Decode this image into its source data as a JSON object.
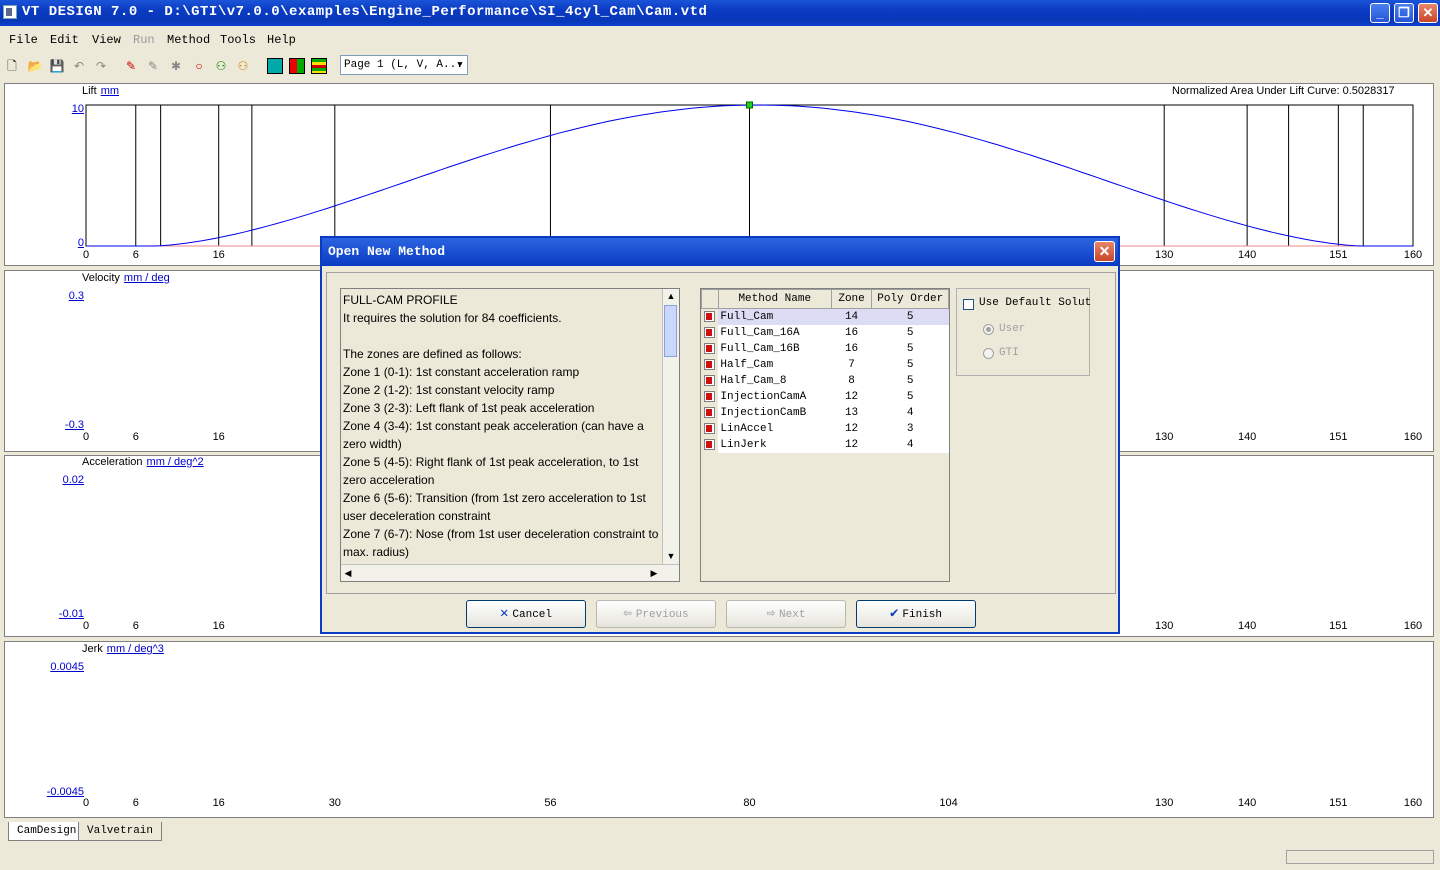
{
  "window": {
    "title": "VT DESIGN 7.0  - D:\\GTI\\v7.0.0\\examples\\Engine_Performance\\SI_4cyl_Cam\\Cam.vtd"
  },
  "menu": [
    "File",
    "Edit",
    "View",
    "Run",
    "Method",
    "Tools",
    "Help"
  ],
  "toolbar": {
    "page_select": "Page 1 (L, V, A..."
  },
  "normalized_area": "Normalized Area Under Lift Curve: 0.5028317",
  "panels": {
    "lift": {
      "name": "Lift",
      "unit": "mm",
      "ymax": "10",
      "ymin": "0"
    },
    "velocity": {
      "name": "Velocity",
      "unit": "mm / deg",
      "ymax": "0.3",
      "ymin": "-0.3"
    },
    "acceleration": {
      "name": "Acceleration",
      "unit": "mm / deg^2",
      "ymax": "0.02",
      "ymin": "-0.01"
    },
    "jerk": {
      "name": "Jerk",
      "unit": "mm / deg^3",
      "ymax": "0.0045",
      "ymin": "-0.0045"
    }
  },
  "xticks": {
    "lift": [
      "0",
      "6",
      "16",
      "130",
      "140",
      "151",
      "160"
    ],
    "velocity": [
      "0",
      "6",
      "16",
      "130",
      "140",
      "151",
      "160"
    ],
    "acceleration": [
      "0",
      "6",
      "16",
      "130",
      "140",
      "151",
      "160"
    ],
    "jerk": [
      "0",
      "6",
      "16",
      "30",
      "56",
      "80",
      "104",
      "130",
      "140",
      "151",
      "160"
    ]
  },
  "tabs": [
    "CamDesign",
    "Valvetrain"
  ],
  "dialog": {
    "title": "Open New Method",
    "description": [
      "FULL-CAM PROFILE",
      "It requires the solution for 84 coefficients.",
      "",
      "The zones are defined as follows:",
      "Zone 1 (0-1): 1st constant acceleration ramp",
      "Zone 2 (1-2): 1st constant velocity ramp",
      "Zone 3 (2-3): Left flank of 1st peak acceleration",
      "Zone 4 (3-4): 1st constant peak acceleration (can have a zero width)",
      "Zone 5 (4-5): Right flank of 1st peak acceleration, to 1st zero acceleration",
      "Zone 6 (5-6): Transition  (from 1st zero acceleration to 1st user deceleration constraint",
      "Zone 7 (6-7): Nose (from 1st user deceleration constraint to max. radius)"
    ],
    "table": {
      "headers": [
        "Method Name",
        "Zone",
        "Poly Order"
      ],
      "rows": [
        [
          "Full_Cam",
          "14",
          "5"
        ],
        [
          "Full_Cam_16A",
          "16",
          "5"
        ],
        [
          "Full_Cam_16B",
          "16",
          "5"
        ],
        [
          "Half_Cam",
          "7",
          "5"
        ],
        [
          "Half_Cam_8",
          "8",
          "5"
        ],
        [
          "InjectionCamA",
          "12",
          "5"
        ],
        [
          "InjectionCamB",
          "13",
          "4"
        ],
        [
          "LinAccel",
          "12",
          "3"
        ],
        [
          "LinJerk",
          "12",
          "4"
        ]
      ]
    },
    "use_default": "Use Default Solut",
    "options": [
      "User",
      "GTI"
    ],
    "buttons": {
      "cancel": "Cancel",
      "previous": "Previous",
      "next": "Next",
      "finish": "Finish"
    }
  }
}
